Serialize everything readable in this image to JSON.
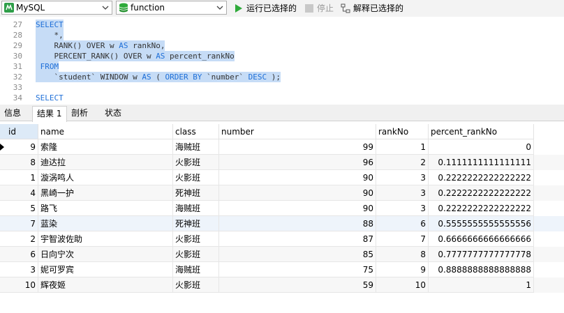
{
  "toolbar": {
    "connection": "MySQL",
    "database": "function",
    "run_selected": "运行已选择的",
    "stop": "停止",
    "explain_selected": "解释已选择的"
  },
  "editor": {
    "lines": [
      {
        "num": "27",
        "segments": [
          {
            "t": "SELECT",
            "kw": true
          }
        ]
      },
      {
        "num": "28",
        "segments": [
          {
            "t": "    *,",
            "kw": false
          }
        ]
      },
      {
        "num": "29",
        "segments": [
          {
            "t": "    RANK() OVER w ",
            "kw": false
          },
          {
            "t": "AS",
            "kw": true
          },
          {
            "t": " rankNo,",
            "kw": false
          }
        ]
      },
      {
        "num": "30",
        "segments": [
          {
            "t": "    PERCENT_RANK() OVER w ",
            "kw": false
          },
          {
            "t": "AS",
            "kw": true
          },
          {
            "t": " percent_rankNo",
            "kw": false
          }
        ]
      },
      {
        "num": "31",
        "segments": [
          {
            "t": " FROM",
            "kw": true
          }
        ]
      },
      {
        "num": "32",
        "segments": [
          {
            "t": "    `student` WINDOW w ",
            "kw": false
          },
          {
            "t": "AS",
            "kw": true
          },
          {
            "t": " ( ",
            "kw": false
          },
          {
            "t": "ORDER BY",
            "kw": true
          },
          {
            "t": " `number` ",
            "kw": false
          },
          {
            "t": "DESC",
            "kw": true
          },
          {
            "t": " );",
            "kw": false
          }
        ]
      },
      {
        "num": "33",
        "segments": []
      },
      {
        "num": "34",
        "segments": [
          {
            "t": "SELECT",
            "kw": true
          }
        ]
      }
    ]
  },
  "tabs": [
    "信息",
    "结果 1",
    "剖析",
    "状态"
  ],
  "columns": [
    "id",
    "name",
    "class",
    "number",
    "rankNo",
    "percent_rankNo"
  ],
  "rows": [
    [
      "9",
      "索隆",
      "海贼班",
      "99",
      "1",
      "0"
    ],
    [
      "8",
      "迪达拉",
      "火影班",
      "96",
      "2",
      "0.1111111111111111"
    ],
    [
      "1",
      "漩涡鸣人",
      "火影班",
      "90",
      "3",
      "0.2222222222222222"
    ],
    [
      "4",
      "黑崎一护",
      "死神班",
      "90",
      "3",
      "0.2222222222222222"
    ],
    [
      "5",
      "路飞",
      "海贼班",
      "90",
      "3",
      "0.2222222222222222"
    ],
    [
      "7",
      "蓝染",
      "死神班",
      "88",
      "6",
      "0.5555555555555556"
    ],
    [
      "2",
      "宇智波佐助",
      "火影班",
      "87",
      "7",
      "0.6666666666666666"
    ],
    [
      "6",
      "日向宁次",
      "火影班",
      "85",
      "8",
      "0.7777777777777778"
    ],
    [
      "3",
      "妮可罗宾",
      "海贼班",
      "75",
      "9",
      "0.8888888888888888"
    ],
    [
      "10",
      "辉夜姬",
      "火影班",
      "59",
      "10",
      "1"
    ]
  ],
  "colors": {
    "selection": "#c6dcf6",
    "keyword": "#1e6fd8",
    "run_green": "#2eaa3a"
  }
}
